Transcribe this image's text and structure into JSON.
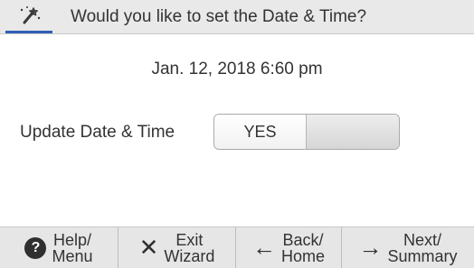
{
  "header": {
    "icon": "magic-wand-icon",
    "title": "Would you like to set the Date & Time?"
  },
  "main": {
    "datetime": "Jan. 12, 2018 6:60 pm",
    "update_label": "Update Date & Time",
    "toggle": {
      "yes_label": "YES",
      "selected": "YES"
    }
  },
  "footer": {
    "help": {
      "icon": "help-icon",
      "line1": "Help/",
      "line2": "Menu"
    },
    "exit": {
      "icon": "close-icon",
      "line1": "Exit",
      "line2": "Wizard"
    },
    "back": {
      "icon": "arrow-left-icon",
      "line1": "Back/",
      "line2": "Home"
    },
    "next": {
      "icon": "arrow-right-icon",
      "line1": "Next/",
      "line2": "Summary"
    }
  },
  "colors": {
    "accent": "#2f5fb3",
    "header_bg": "#e9e9e9",
    "footer_bg": "#e6e6e6"
  }
}
